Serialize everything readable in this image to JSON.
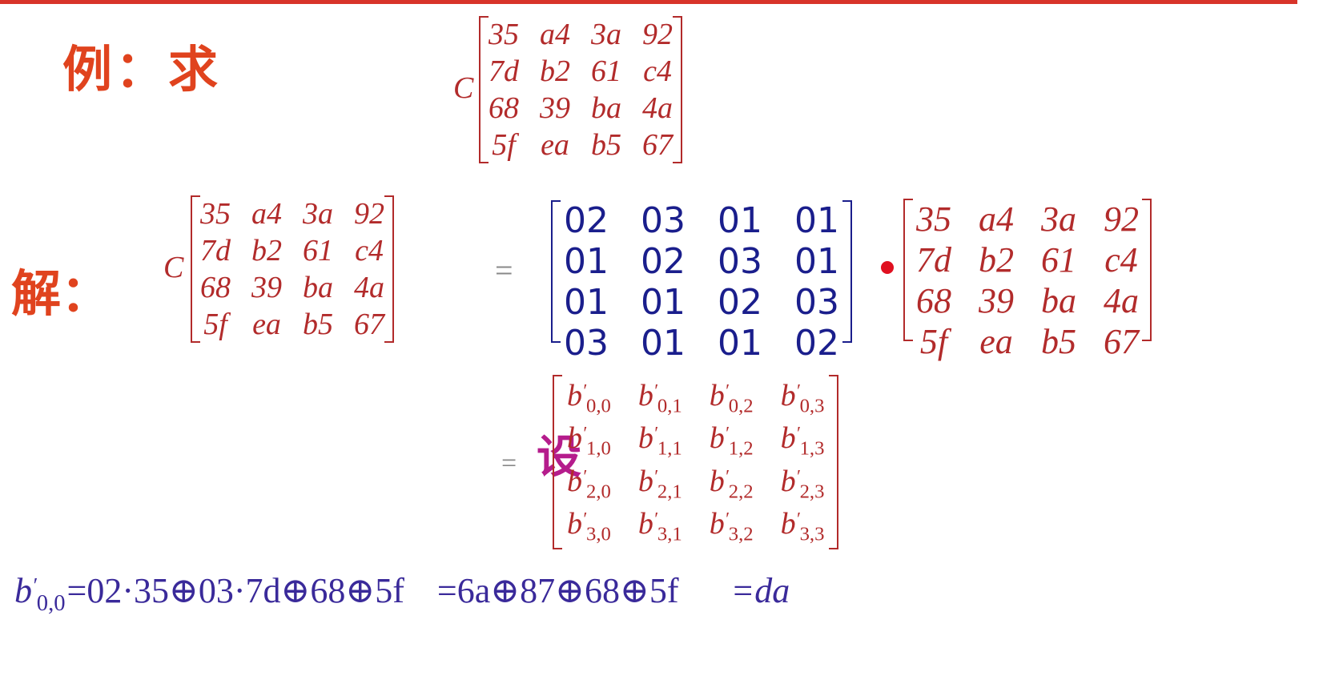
{
  "labels": {
    "example": "例：求",
    "solve": "解：",
    "let": "设"
  },
  "var_c": "C",
  "equals": "=",
  "state_matrix": [
    [
      "35",
      "a4",
      "3a",
      "92"
    ],
    [
      "7d",
      "b2",
      "61",
      "c4"
    ],
    [
      "68",
      "39",
      "ba",
      "4a"
    ],
    [
      "5f",
      "ea",
      "b5",
      "67"
    ]
  ],
  "mix_matrix": [
    [
      "02",
      "03",
      "01",
      "01"
    ],
    [
      "01",
      "02",
      "03",
      "01"
    ],
    [
      "01",
      "01",
      "02",
      "03"
    ],
    [
      "03",
      "01",
      "01",
      "02"
    ]
  ],
  "b_matrix": [
    [
      "0,0",
      "0,1",
      "0,2",
      "0,3"
    ],
    [
      "1,0",
      "1,1",
      "1,2",
      "1,3"
    ],
    [
      "2,0",
      "2,1",
      "2,2",
      "2,3"
    ],
    [
      "3,0",
      "3,1",
      "3,2",
      "3,3"
    ]
  ],
  "formula": {
    "lhs_sub": "0,0",
    "step1": "=02·35⊕03·7d⊕68⊕5f",
    "step2": "=6a⊕87⊕68⊕5f",
    "result": "=da"
  },
  "colors": {
    "title_red": "#e0431e",
    "matrix_red": "#b22b2b",
    "matrix_blue": "#1a1e8c",
    "let_magenta": "#b51c8c",
    "formula_purple": "#3a2a9a"
  }
}
